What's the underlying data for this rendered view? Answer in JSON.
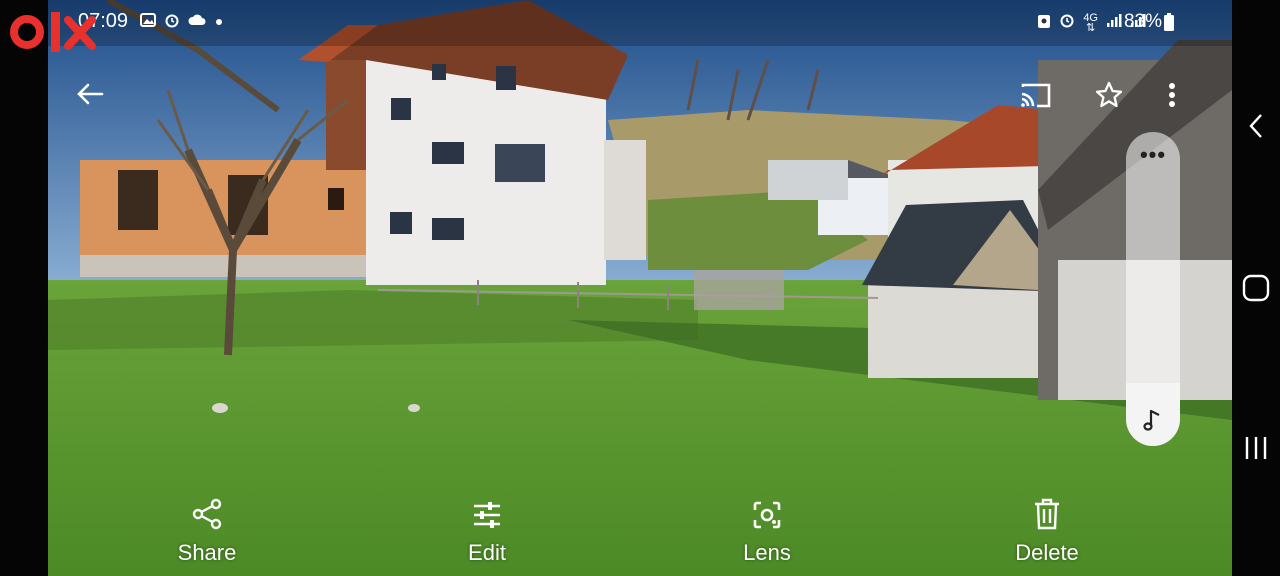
{
  "status_bar": {
    "time": "07:09",
    "left_icons": [
      "gallery-icon",
      "alarm-icon",
      "cloud-icon",
      "dot-icon"
    ],
    "right_icons": [
      "nfc-lock-icon",
      "alarm-icon",
      "4g-icon",
      "signal-icon",
      "signal-icon",
      "battery-icon"
    ],
    "network": "4G",
    "battery": "83%"
  },
  "watermark": {
    "brand": "olx"
  },
  "top_controls": [
    "back-arrow-icon",
    "cast-icon",
    "favorite-star-icon",
    "more-vert-icon"
  ],
  "volume": {
    "level": 0.2,
    "dots": "•••",
    "icon": "music-note-icon"
  },
  "actions": {
    "share": "Share",
    "edit": "Edit",
    "lens": "Lens",
    "delete": "Delete"
  },
  "nav": [
    "back-nav-icon",
    "home-nav-icon",
    "recents-nav-icon"
  ],
  "colors": {
    "sky": "#2f5f9c",
    "grass": "#5e9a34",
    "roof": "#a8482a",
    "olx_red": "#e8302d"
  }
}
